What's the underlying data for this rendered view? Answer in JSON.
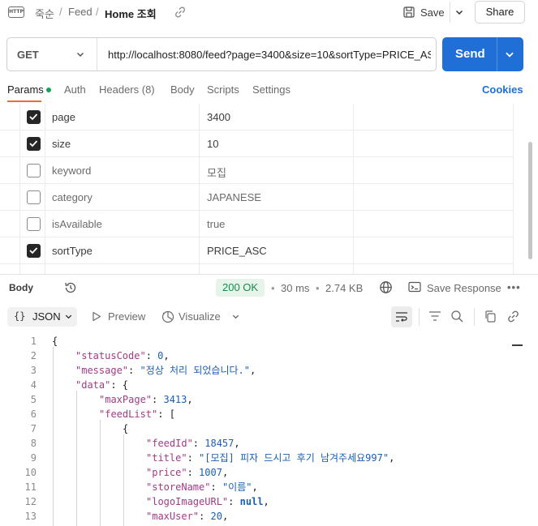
{
  "breadcrumb": {
    "icon_text": "HTTP",
    "collection": "죽순",
    "folder": "Feed",
    "request": "Home 조회",
    "separator": "/"
  },
  "toolbar": {
    "save_label": "Save",
    "share_label": "Share"
  },
  "request": {
    "method": "GET",
    "url": "http://localhost:8080/feed?page=3400&size=10&sortType=PRICE_ASC",
    "send_label": "Send"
  },
  "param_tabs": {
    "items": [
      {
        "label": "Params",
        "active": true,
        "has_dot": true
      },
      {
        "label": "Auth"
      },
      {
        "label": "Headers (8)"
      },
      {
        "label": "Body"
      },
      {
        "label": "Scripts"
      },
      {
        "label": "Settings"
      }
    ],
    "cookies_label": "Cookies"
  },
  "params": [
    {
      "key": "page",
      "value": "3400",
      "checked": true
    },
    {
      "key": "size",
      "value": "10",
      "checked": true
    },
    {
      "key": "keyword",
      "value": "모집",
      "checked": false
    },
    {
      "key": "category",
      "value": "JAPANESE",
      "checked": false
    },
    {
      "key": "isAvailable",
      "value": "true",
      "checked": false
    },
    {
      "key": "sortType",
      "value": "PRICE_ASC",
      "checked": true
    }
  ],
  "response": {
    "body_label": "Body",
    "status": "200 OK",
    "time": "30 ms",
    "size": "2.74 KB",
    "save_label": "Save Response"
  },
  "viewer": {
    "format_label": "JSON",
    "format_brace": "{}",
    "preview_label": "Preview",
    "visualize_label": "Visualize"
  },
  "code_lines": [
    {
      "n": "1",
      "indent": 0,
      "parts": [
        [
          "p",
          "{"
        ]
      ]
    },
    {
      "n": "2",
      "indent": 1,
      "parts": [
        [
          "k",
          "\"statusCode\""
        ],
        [
          "p",
          ": "
        ],
        [
          "n",
          "0"
        ],
        [
          "p",
          ","
        ]
      ]
    },
    {
      "n": "3",
      "indent": 1,
      "parts": [
        [
          "k",
          "\"message\""
        ],
        [
          "p",
          ": "
        ],
        [
          "s",
          "\"정상 처리 되었습니다.\""
        ],
        [
          "p",
          ","
        ]
      ]
    },
    {
      "n": "4",
      "indent": 1,
      "parts": [
        [
          "k",
          "\"data\""
        ],
        [
          "p",
          ": {"
        ]
      ]
    },
    {
      "n": "5",
      "indent": 2,
      "parts": [
        [
          "k",
          "\"maxPage\""
        ],
        [
          "p",
          ": "
        ],
        [
          "n",
          "3413"
        ],
        [
          "p",
          ","
        ]
      ]
    },
    {
      "n": "6",
      "indent": 2,
      "parts": [
        [
          "k",
          "\"feedList\""
        ],
        [
          "p",
          ": ["
        ]
      ]
    },
    {
      "n": "7",
      "indent": 3,
      "parts": [
        [
          "p",
          "{"
        ]
      ]
    },
    {
      "n": "8",
      "indent": 4,
      "parts": [
        [
          "k",
          "\"feedId\""
        ],
        [
          "p",
          ": "
        ],
        [
          "n",
          "18457"
        ],
        [
          "p",
          ","
        ]
      ]
    },
    {
      "n": "9",
      "indent": 4,
      "parts": [
        [
          "k",
          "\"title\""
        ],
        [
          "p",
          ": "
        ],
        [
          "s",
          "\"[모집] 피자 드시고 후기 남겨주세요997\""
        ],
        [
          "p",
          ","
        ]
      ]
    },
    {
      "n": "10",
      "indent": 4,
      "parts": [
        [
          "k",
          "\"price\""
        ],
        [
          "p",
          ": "
        ],
        [
          "n",
          "1007"
        ],
        [
          "p",
          ","
        ]
      ]
    },
    {
      "n": "11",
      "indent": 4,
      "parts": [
        [
          "k",
          "\"storeName\""
        ],
        [
          "p",
          ": "
        ],
        [
          "s",
          "\"이름\""
        ],
        [
          "p",
          ","
        ]
      ]
    },
    {
      "n": "12",
      "indent": 4,
      "parts": [
        [
          "k",
          "\"logoImageURL\""
        ],
        [
          "p",
          ": "
        ],
        [
          "nl",
          "null"
        ],
        [
          "p",
          ","
        ]
      ]
    },
    {
      "n": "13",
      "indent": 4,
      "parts": [
        [
          "k",
          "\"maxUser\""
        ],
        [
          "p",
          ": "
        ],
        [
          "n",
          "20"
        ],
        [
          "p",
          ","
        ]
      ]
    }
  ],
  "colors": {
    "accent": "#1f6fd6",
    "tab_underline": "#f06a35",
    "status_ok": "#1a8a4a",
    "json_key": "#a33a87",
    "json_value": "#1a5fb4"
  },
  "icons": [
    "http-icon",
    "link-icon",
    "save-icon",
    "chevron-down-icon",
    "history-icon",
    "globe-icon",
    "save-response-icon",
    "more-icon",
    "preview-icon",
    "visualize-icon",
    "wrap-icon",
    "filter-icon",
    "search-icon",
    "copy-icon",
    "link-icon"
  ]
}
